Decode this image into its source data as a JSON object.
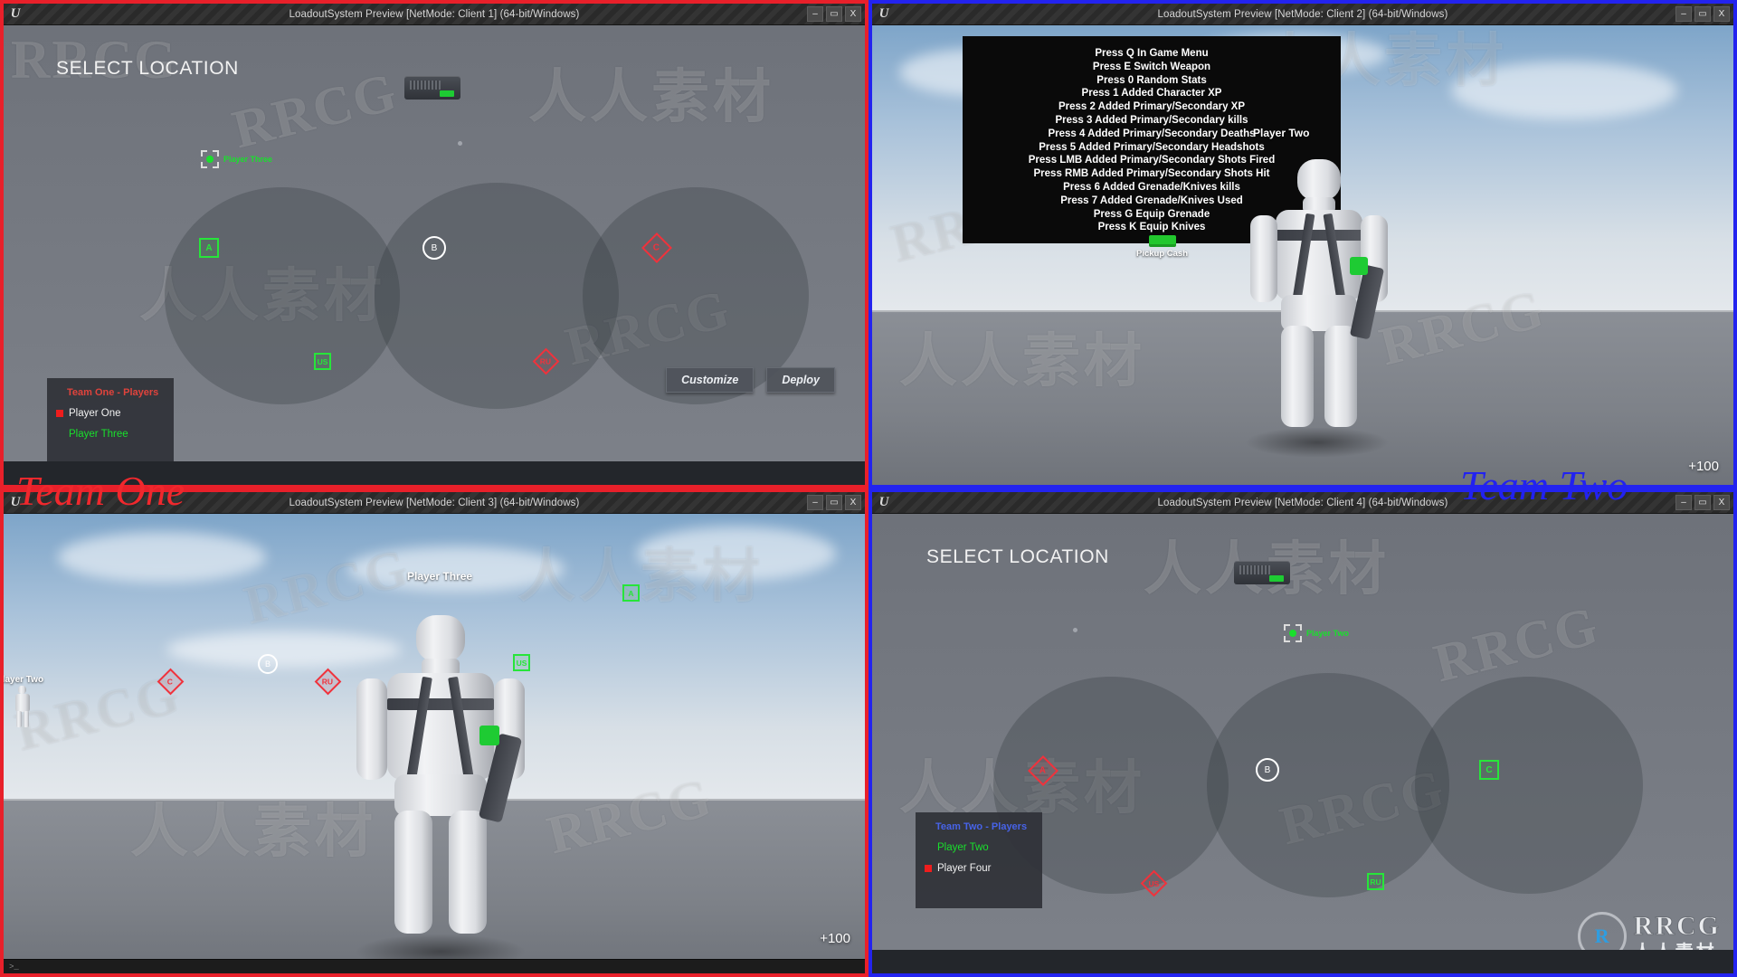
{
  "windows": {
    "client1": {
      "title": "LoadoutSystem Preview [NetMode: Client 1] (64-bit/Windows)",
      "minimize": "–",
      "maximize": "▭",
      "close": "X"
    },
    "client2": {
      "title": "LoadoutSystem Preview [NetMode: Client 2] (64-bit/Windows)",
      "minimize": "–",
      "maximize": "▭",
      "close": "X"
    },
    "client3": {
      "title": "LoadoutSystem Preview [NetMode: Client 3] (64-bit/Windows)",
      "minimize": "–",
      "maximize": "▭",
      "close": "X"
    },
    "client4": {
      "title": "LoadoutSystem Preview [NetMode: Client 4] (64-bit/Windows)",
      "minimize": "–",
      "maximize": "▭",
      "close": "X"
    }
  },
  "client1": {
    "heading": "SELECT LOCATION",
    "beacon_label": "Player Three",
    "markers": [
      {
        "id": "A",
        "shape": "square",
        "color": "#27e53a"
      },
      {
        "id": "B",
        "shape": "circle",
        "color": "#ffffff"
      },
      {
        "id": "C",
        "shape": "diamond",
        "color": "#f0323c"
      },
      {
        "id": "US",
        "shape": "square",
        "color": "#27e53a"
      },
      {
        "id": "RU",
        "shape": "diamond",
        "color": "#f0323c"
      }
    ],
    "team_panel": {
      "title": "Team One - Players",
      "title_color": "#e0433c",
      "players": [
        {
          "name": "Player One",
          "color": "white",
          "marker": true
        },
        {
          "name": "Player Three",
          "color": "green",
          "marker": false
        }
      ]
    },
    "buttons": {
      "customize": "Customize",
      "deploy": "Deploy"
    }
  },
  "client2": {
    "instructions": [
      "Press Q In Game Menu",
      "Press E Switch Weapon",
      "Press 0 Random Stats",
      "Press 1 Added Character XP",
      "Press 2 Added Primary/Secondary XP",
      "Press 3 Added Primary/Secondary kills",
      "Press 4 Added Primary/Secondary Deaths",
      "Press 5 Added Primary/Secondary Headshots",
      "Press LMB Added Primary/Secondary Shots Fired",
      "Press RMB Added Primary/Secondary Shots Hit",
      "Press 6 Added Grenade/Knives kills",
      "Press 7 Added Grenade/Knives Used",
      "Press G Equip Grenade",
      "Press K Equip Knives"
    ],
    "character_name": "Player Two",
    "pickup_label": "Pickup Cash",
    "score": "+100"
  },
  "client3": {
    "character_name": "Player Three",
    "other_player": "Player Two",
    "markers": [
      {
        "id": "A",
        "shape": "square",
        "color": "#27e53a"
      },
      {
        "id": "B",
        "shape": "circle",
        "color": "#ffffff"
      },
      {
        "id": "C",
        "shape": "diamond",
        "color": "#f0323c"
      },
      {
        "id": "US",
        "shape": "square",
        "color": "#27e53a"
      },
      {
        "id": "RU",
        "shape": "diamond",
        "color": "#f0323c"
      }
    ],
    "score": "+100",
    "console_prompt": ">_"
  },
  "client4": {
    "heading": "SELECT LOCATION",
    "beacon_label": "Player Two",
    "markers": [
      {
        "id": "A",
        "shape": "diamond",
        "color": "#f0323c"
      },
      {
        "id": "B",
        "shape": "circle",
        "color": "#ffffff"
      },
      {
        "id": "C",
        "shape": "square",
        "color": "#27e53a"
      },
      {
        "id": "US",
        "shape": "diamond",
        "color": "#f0323c"
      },
      {
        "id": "RU",
        "shape": "square",
        "color": "#27e53a"
      }
    ],
    "team_panel": {
      "title": "Team Two - Players",
      "title_color": "#4763e8",
      "players": [
        {
          "name": "Player Two",
          "color": "green",
          "marker": false
        },
        {
          "name": "Player Four",
          "color": "white",
          "marker": true
        }
      ]
    }
  },
  "annotations": {
    "team_one": "Team One",
    "team_one_color": "#f0282d",
    "team_two": "Team Two",
    "team_two_color": "#2222f0"
  },
  "watermarks": {
    "rrcg": "RRCG",
    "chinese": "人人素材",
    "logo_mark": "R",
    "logo_name": "RRCG",
    "logo_cn": "人人素材"
  },
  "ue_icon": "U"
}
